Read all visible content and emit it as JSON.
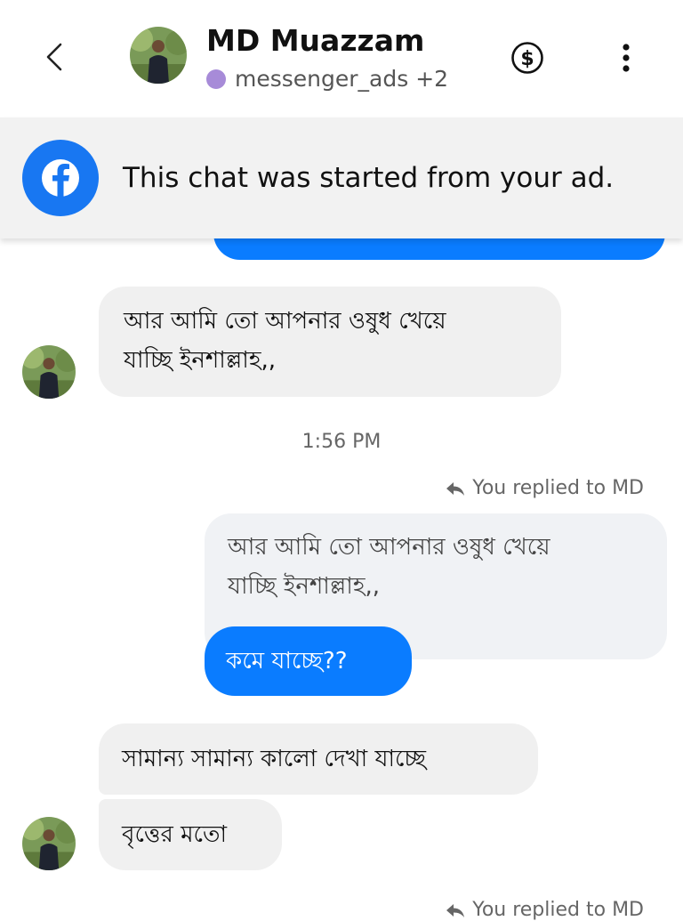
{
  "header": {
    "back_icon": "chevron-left-icon",
    "contact_name": "MD Muazzam",
    "source_label": "messenger_ads +2",
    "source_dot_color": "#a78bd8",
    "dollar_icon": "dollar-circle-icon",
    "more_icon": "vertical-ellipsis-icon"
  },
  "banner": {
    "icon": "facebook-logo-icon",
    "text": "This chat was started from your ad."
  },
  "messages": [
    {
      "direction": "incoming",
      "lines": [
        "আর আমি তো আপনার ওষুধ খেয়ে",
        "যাচ্ছি ইনশাল্লাহ,,"
      ]
    },
    {
      "timestamp": "1:56 PM"
    },
    {
      "reply_label": "You replied to MD",
      "quoted_lines": [
        "আর আমি তো আপনার ওষুধ খেয়ে",
        "যাচ্ছি ইনশাল্লাহ,,"
      ],
      "direction": "outgoing",
      "text": "কমে যাচ্ছে??"
    },
    {
      "direction": "incoming",
      "text": "সামান্য সামান্য কালো দেখা যাচ্ছে"
    },
    {
      "direction": "incoming",
      "text": "বৃত্তের মতো"
    },
    {
      "reply_label": "You replied to MD"
    }
  ],
  "colors": {
    "accent": "#0a7cff",
    "incoming_bubble": "#f0f0f0",
    "banner_bg": "#f2f2f2",
    "facebook_blue": "#1877f2"
  }
}
